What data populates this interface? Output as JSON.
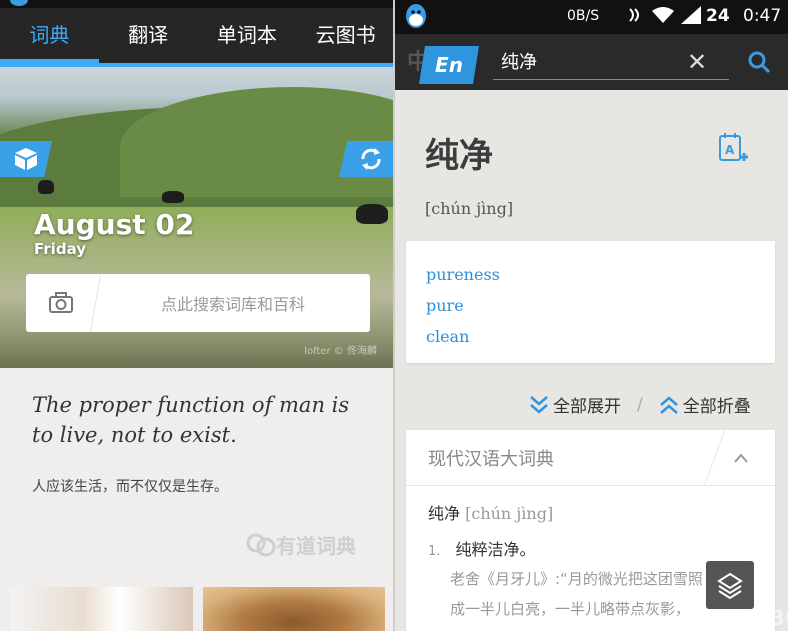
{
  "left_app": {
    "tabs": [
      {
        "label": "词典",
        "active": true
      },
      {
        "label": "翻译",
        "active": false
      },
      {
        "label": "单词本",
        "active": false
      },
      {
        "label": "云图书",
        "active": false
      }
    ],
    "hero": {
      "date": "August 02",
      "weekday": "Friday",
      "credit": "lofter © 佟海麟",
      "left_icon": "cube-icon",
      "right_icon": "refresh-icon"
    },
    "search": {
      "placeholder": "点此搜索词库和百科",
      "icon": "camera-icon"
    },
    "quote": {
      "english": "The proper function of man is to live, not to exist.",
      "chinese": "人应该生活，而不仅仅是生存。"
    },
    "brand": "有道词典",
    "colors": {
      "accent": "#3fa9f5",
      "tabbar": "#262626",
      "background": "#efeeec"
    }
  },
  "right_app": {
    "status_bar": {
      "network_speed": "0B/S",
      "battery": "24",
      "time": "0:47"
    },
    "search_bar": {
      "lang_hint": "中",
      "lang_badge": "En",
      "query": "纯净",
      "clear_icon": "✕"
    },
    "entry": {
      "word": "纯净",
      "pinyin": "[chún jìng]",
      "translations": [
        "pureness",
        "pure",
        "clean"
      ]
    },
    "toggles": {
      "expand_all": "全部展开",
      "separator": "/",
      "collapse_all": "全部折叠"
    },
    "dictionary": {
      "title": "现代汉语大词典",
      "headword": "纯净",
      "headword_pinyin": "[chún jìng]",
      "sense_number": "1.",
      "sense": "纯粹洁净。",
      "example_line1": "老舍《月牙儿》:“月的微光把这团雪照",
      "example_line2": "成一半儿白亮，一半儿略带点灰影，"
    },
    "watermark": "www.2u4230.com",
    "colors": {
      "accent": "#2f95dc",
      "link": "#2d8fd5",
      "background": "#e8e6e3"
    }
  }
}
